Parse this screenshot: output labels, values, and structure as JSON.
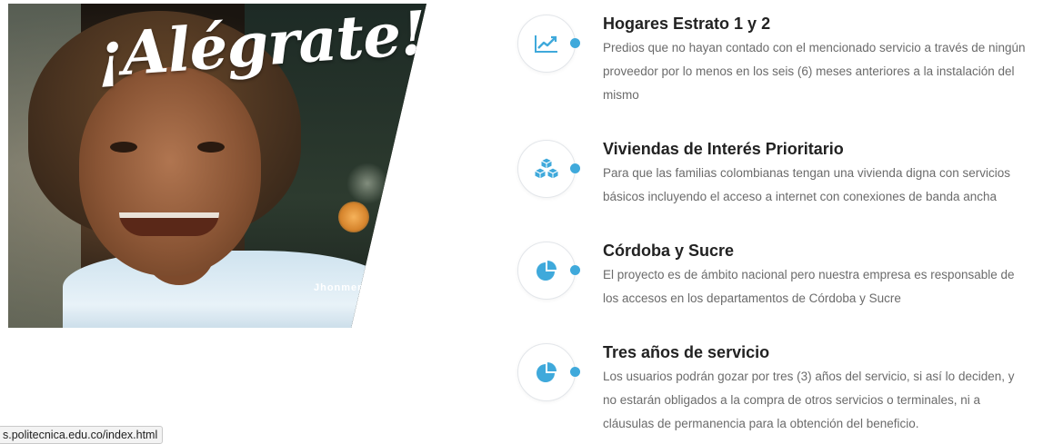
{
  "hero": {
    "title": "¡Alégrate!",
    "credit": "Jhonmer"
  },
  "features": [
    {
      "icon": "line-chart-icon",
      "title": "Hogares Estrato 1 y 2",
      "text": "Predios que no hayan contado con el mencionado servicio a través de ningún proveedor por lo menos en los seis (6) meses anteriores a la instalación del mismo"
    },
    {
      "icon": "cubes-icon",
      "title": "Viviendas de Interés Prioritario",
      "text": "Para que las familias colombianas tengan una vivienda digna con servicios básicos incluyendo el acceso a internet con conexiones de banda ancha"
    },
    {
      "icon": "pie-chart-icon",
      "title": "Córdoba y Sucre",
      "text": "El proyecto es de ámbito nacional pero nuestra empresa es responsable de los accesos en los departamentos de Córdoba y Sucre"
    },
    {
      "icon": "pie-chart-icon",
      "title": "Tres años de servicio",
      "text": "Los usuarios podrán gozar por tres (3) años del servicio, si así lo deciden, y no estarán obligados a la compra de otros servicios o terminales, ni a cláusulas de permanencia para la obtención del beneficio."
    }
  ],
  "status_bar": {
    "url": "s.politecnica.edu.co/index.html"
  },
  "colors": {
    "accent": "#3fa9db",
    "heading": "#222222",
    "body_text": "#6b6b6b"
  }
}
